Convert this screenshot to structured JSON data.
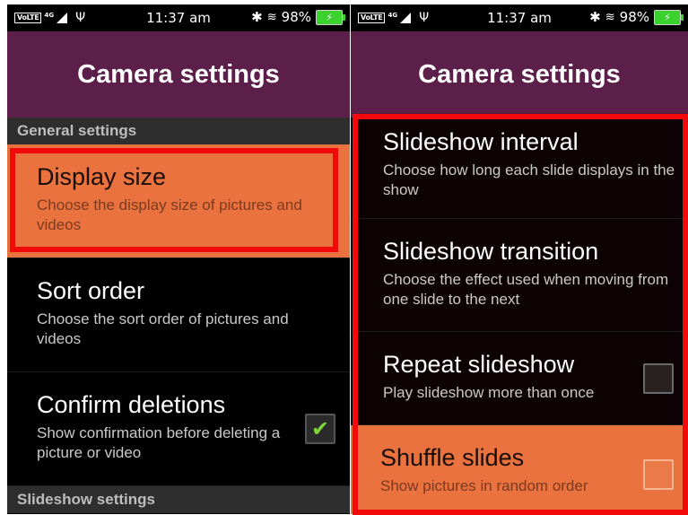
{
  "status_bar": {
    "volte_label": "VoLTE",
    "network_label": "4G",
    "time": "11:37 am",
    "battery_percent": "98%",
    "icons": [
      "signal-icon",
      "usb-icon",
      "bluetooth-icon",
      "vibrate-icon",
      "battery-charging-icon"
    ]
  },
  "left_screen": {
    "title": "Camera settings",
    "section_general": "General settings",
    "items": [
      {
        "title": "Display size",
        "summary": "Choose the display size of pictures and videos",
        "selected": true
      },
      {
        "title": "Sort order",
        "summary": "Choose the sort order of pictures and videos",
        "selected": false
      },
      {
        "title": "Confirm deletions",
        "summary": "Show confirmation before deleting a picture or video",
        "checked": true
      }
    ],
    "section_slideshow": "Slideshow settings"
  },
  "right_screen": {
    "title": "Camera settings",
    "items": [
      {
        "title": "Slideshow interval",
        "summary": "Choose how long each slide displays in the show"
      },
      {
        "title": "Slideshow transition",
        "summary": "Choose the effect used when moving from one slide to the next"
      },
      {
        "title": "Repeat slideshow",
        "summary": "Play slideshow more than once",
        "checked": false
      },
      {
        "title": "Shuffle slides",
        "summary": "Show pictures in random order",
        "checked": false,
        "selected": true
      }
    ]
  },
  "colors": {
    "app_bar": "#5b1f4a",
    "selected_item": "#e9723f",
    "annotation_box": "#f20a0a",
    "checkmark": "#7ed63a"
  }
}
